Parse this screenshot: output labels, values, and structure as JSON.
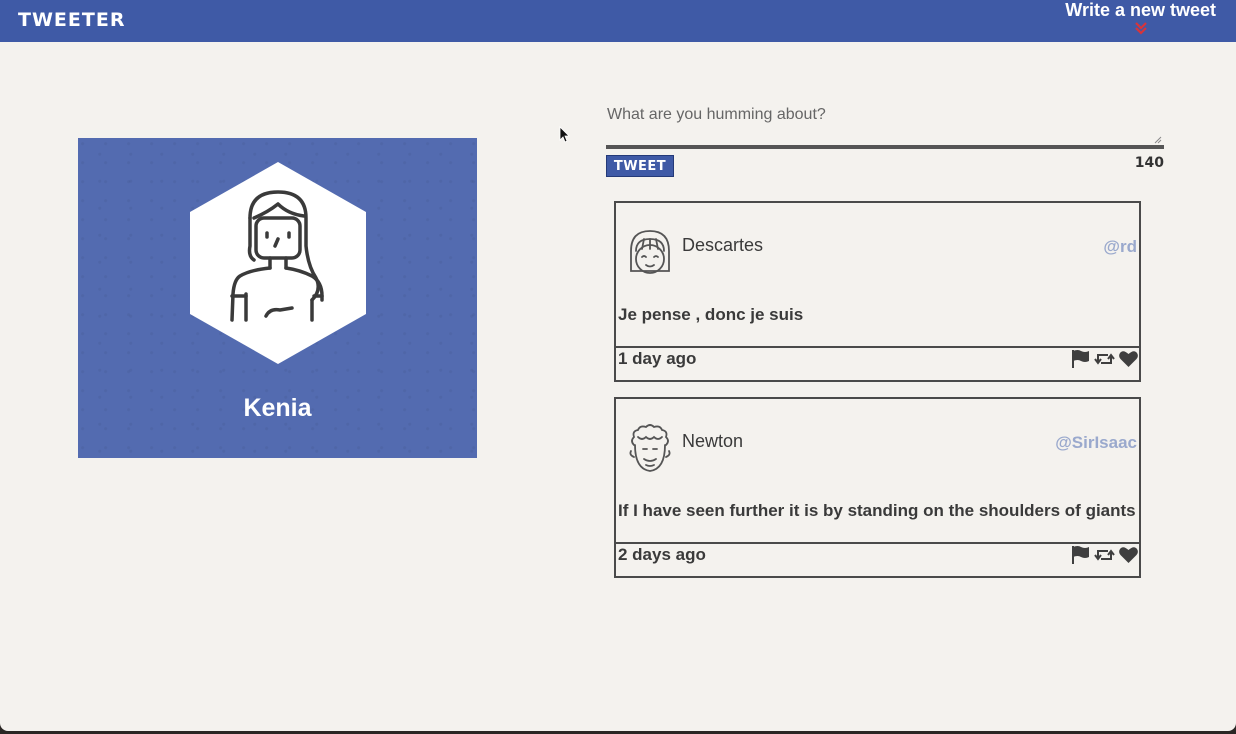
{
  "navbar": {
    "brand": "TWEETER",
    "compose_toggle_label": "Write a new tweet",
    "compose_toggle_icon": "double-chevron-down-icon",
    "colors": {
      "background": "#3f5aa6",
      "chevron": "#d8343a"
    }
  },
  "profile": {
    "name": "Kenia",
    "avatar_icon": "female-avatar-icon",
    "card_color": "#536bb0"
  },
  "composer": {
    "placeholder": "What are you humming about?",
    "value": "",
    "submit_label": "TWEET",
    "char_counter": "140"
  },
  "tweets": [
    {
      "name": "Descartes",
      "handle": "@rd",
      "text": "Je pense , donc je suis",
      "time": "1 day ago",
      "avatar_icon": "girl-face-avatar-icon"
    },
    {
      "name": "Newton",
      "handle": "@SirIsaac",
      "text": "If I have seen further it is by standing on the shoulders of giants",
      "time": "2 days ago",
      "avatar_icon": "curly-hair-avatar-icon"
    }
  ],
  "tweet_actions": [
    "flag-icon",
    "retweet-icon",
    "heart-icon"
  ]
}
